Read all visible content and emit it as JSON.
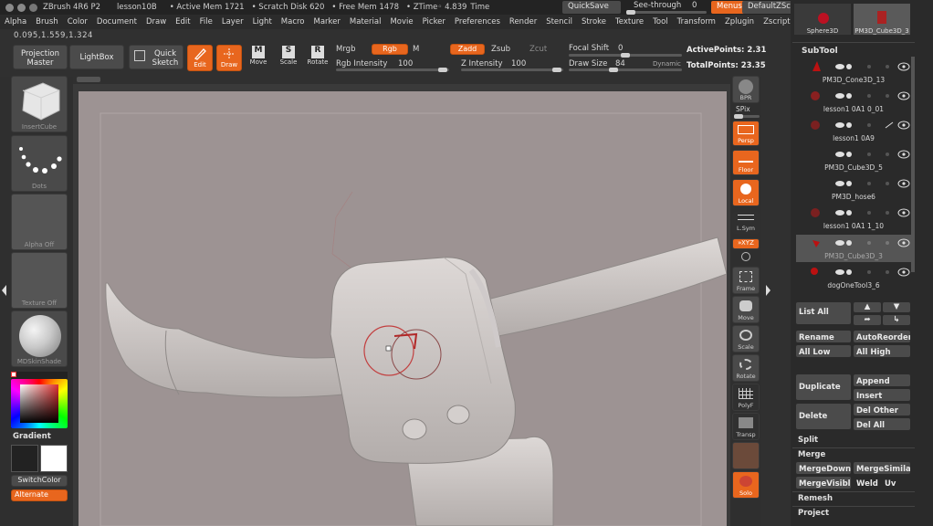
{
  "window": {
    "title": "ZBrush 4R6 P2",
    "doc": "lesson10B",
    "active_mem": "• Active Mem 1721",
    "scratch": "• Scratch Disk 620",
    "free_mem": "• Free Mem 1478",
    "ztime": "• ZTime◦ 4.839",
    "timer_label": "Time",
    "quicksave": "QuickSave",
    "see_through": "See-through",
    "see_through_val": "0",
    "menus": "Menus",
    "default_script": "DefaultZScript"
  },
  "menubar": [
    "Alpha",
    "Brush",
    "Color",
    "Document",
    "Draw",
    "Edit",
    "File",
    "Layer",
    "Light",
    "Macro",
    "Marker",
    "Material",
    "Movie",
    "Picker",
    "Preferences",
    "Render",
    "Stencil",
    "Stroke",
    "Texture",
    "Tool",
    "Transform",
    "Zplugin",
    "Zscript"
  ],
  "coords": "0.095,1.559,1.324",
  "toolbar": {
    "projection_master": "Projection Master",
    "lightbox": "LightBox",
    "quick_sketch": "Quick Sketch",
    "edit": "Edit",
    "draw": "Draw",
    "move": "Move",
    "scale": "Scale",
    "rotate": "Rotate",
    "mrgb": "Mrgb",
    "rgb": "Rgb",
    "m": "M",
    "zadd": "Zadd",
    "zsub": "Zsub",
    "zcut": "Zcut",
    "rgb_intensity_label": "Rgb Intensity",
    "rgb_intensity": "100",
    "z_intensity_label": "Z Intensity",
    "z_intensity": "100",
    "focal_shift_label": "Focal Shift",
    "focal_shift": "0",
    "draw_size_label": "Draw Size",
    "draw_size": "84",
    "dynamic": "Dynamic",
    "active_points": "ActivePoints: 2.31",
    "total_points": "TotalPoints: 23.35"
  },
  "left_shelf": {
    "insert_cube": "InsertCube",
    "dots": "Dots",
    "alpha_off": "Alpha Off",
    "texture_off": "Texture Off",
    "material": "MDSkinShade",
    "gradient": "Gradient",
    "switch_color": "SwitchColor",
    "alternate": "Alternate"
  },
  "right_shelf": {
    "bpr": "BPR",
    "spix": "SPix",
    "persp": "Persp",
    "floor": "Floor",
    "local": "Local",
    "lsym": "L.Sym",
    "xyz": "»XYZ",
    "frame": "Frame",
    "move": "Move",
    "scale": "Scale",
    "rotate": "Rotate",
    "polyf": "PolyF",
    "transp": "Transp",
    "solo": "Solo"
  },
  "subtool": {
    "thumb1": "Sphere3D",
    "thumb2": "PM3D_Cube3D_3",
    "header": "SubTool",
    "items": [
      {
        "name": "PM3D_Cone3D_13"
      },
      {
        "name": "lesson1 0A1 0_01"
      },
      {
        "name": "lesson1 0A9"
      },
      {
        "name": "PM3D_Cube3D_5"
      },
      {
        "name": "PM3D_hose6"
      },
      {
        "name": "lesson1 0A1 1_10"
      },
      {
        "name": "PM3D_Cube3D_3"
      },
      {
        "name": "dogOneTool3_6"
      }
    ],
    "list_all": "List All",
    "rename": "Rename",
    "auto_reorder": "AutoReorder",
    "all_low": "All Low",
    "all_high": "All High",
    "duplicate": "Duplicate",
    "append": "Append",
    "insert": "Insert",
    "delete": "Delete",
    "del_other": "Del Other",
    "del_all": "Del All",
    "split": "Split",
    "merge": "Merge",
    "merge_down": "MergeDown",
    "merge_similar": "MergeSimilar",
    "merge_visible": "MergeVisible",
    "weld": "Weld",
    "uv": "Uv",
    "remesh": "Remesh",
    "project": "Project"
  },
  "colors": {
    "accent": "#e8661e",
    "canvas": "#9d9393",
    "panel": "#2a2a2a"
  }
}
